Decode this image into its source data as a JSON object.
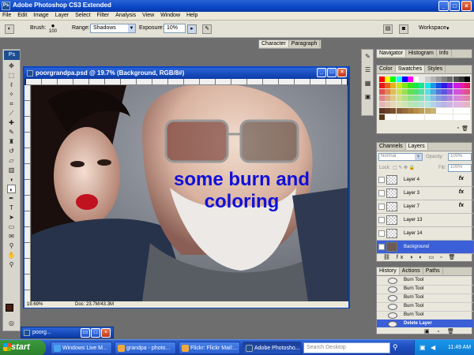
{
  "window": {
    "title": "Adobe Photoshop CS3 Extended",
    "app_icon": "Ps"
  },
  "menu": [
    "File",
    "Edit",
    "Image",
    "Layer",
    "Select",
    "Filter",
    "Analysis",
    "View",
    "Window",
    "Help"
  ],
  "options": {
    "brush_label": "Brush:",
    "brush_size": "100",
    "range_label": "Range:",
    "range_value": "Shadows",
    "exposure_label": "Exposure:",
    "exposure_value": "10%",
    "workspace_label": "Workspace"
  },
  "top_tabs": {
    "character": "Character",
    "paragraph": "Paragraph"
  },
  "document": {
    "title": "poorgrandpa.psd @ 19.7% (Background, RGB/8#)",
    "overlay_line1": "some burn and",
    "overlay_line2": "coloring",
    "zoom": "19.69%",
    "doc_info": "Doc: 23.7M/43.3M"
  },
  "minimized_doc": "poorg...",
  "navigator_tabs": [
    "Navigator",
    "Histogram",
    "Info"
  ],
  "swatch_tabs": [
    "Color",
    "Swatches",
    "Styles"
  ],
  "layers_panel": {
    "tabs": [
      "Channels",
      "Layers"
    ],
    "blend_mode": "Normal",
    "opacity_label": "Opacity:",
    "opacity": "100%",
    "lock_label": "Lock:",
    "fill_label": "Fill:",
    "fill": "100%",
    "layers": [
      {
        "name": "Layer 4",
        "fx": "fx"
      },
      {
        "name": "Layer 3",
        "fx": "fx"
      },
      {
        "name": "Layer 7",
        "fx": "fx"
      },
      {
        "name": "Layer 13",
        "fx": ""
      },
      {
        "name": "Layer 14",
        "fx": ""
      },
      {
        "name": "Background",
        "fx": ""
      }
    ]
  },
  "history_panel": {
    "tabs": [
      "History",
      "Actions",
      "Paths"
    ],
    "items": [
      "Burn Tool",
      "Burn Tool",
      "Burn Tool",
      "Burn Tool",
      "Burn Tool",
      "Delete Layer"
    ]
  },
  "taskbar": {
    "start": "start",
    "tasks": [
      "Windows Live M...",
      "grandpa - photo...",
      "Flickr: Flickr Mail:...",
      "Adobe Photosho..."
    ],
    "search_placeholder": "Search Desktop",
    "time": "11:49 AM"
  },
  "colors": {
    "accent": "#0b46c6",
    "overlay_text": "#1010d8",
    "selected_layer": "#3a5fd6"
  }
}
